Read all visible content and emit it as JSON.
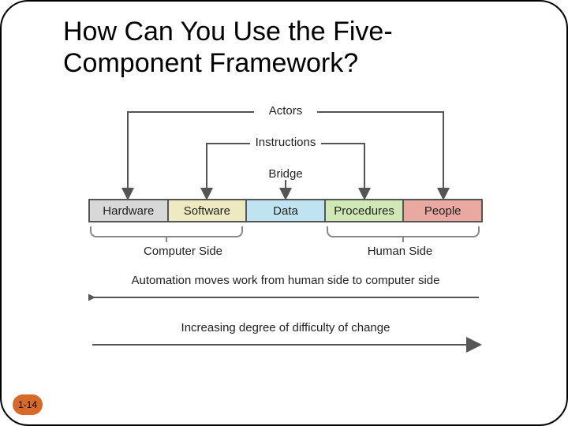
{
  "slide": {
    "title": "How Can You Use the Five-Component Framework?",
    "page_number": "1-14"
  },
  "diagram": {
    "labels": {
      "actors": "Actors",
      "instructions": "Instructions",
      "bridge": "Bridge",
      "computer_side": "Computer Side",
      "human_side": "Human Side",
      "automation": "Automation moves work from human side to computer side",
      "difficulty": "Increasing degree of difficulty of change"
    },
    "components": [
      {
        "label": "Hardware",
        "color": "#d8d8d8"
      },
      {
        "label": "Software",
        "color": "#edeac2"
      },
      {
        "label": "Data",
        "color": "#bfe3f0"
      },
      {
        "label": "Procedures",
        "color": "#cfe8b6"
      },
      {
        "label": "People",
        "color": "#e9a9a0"
      }
    ]
  }
}
